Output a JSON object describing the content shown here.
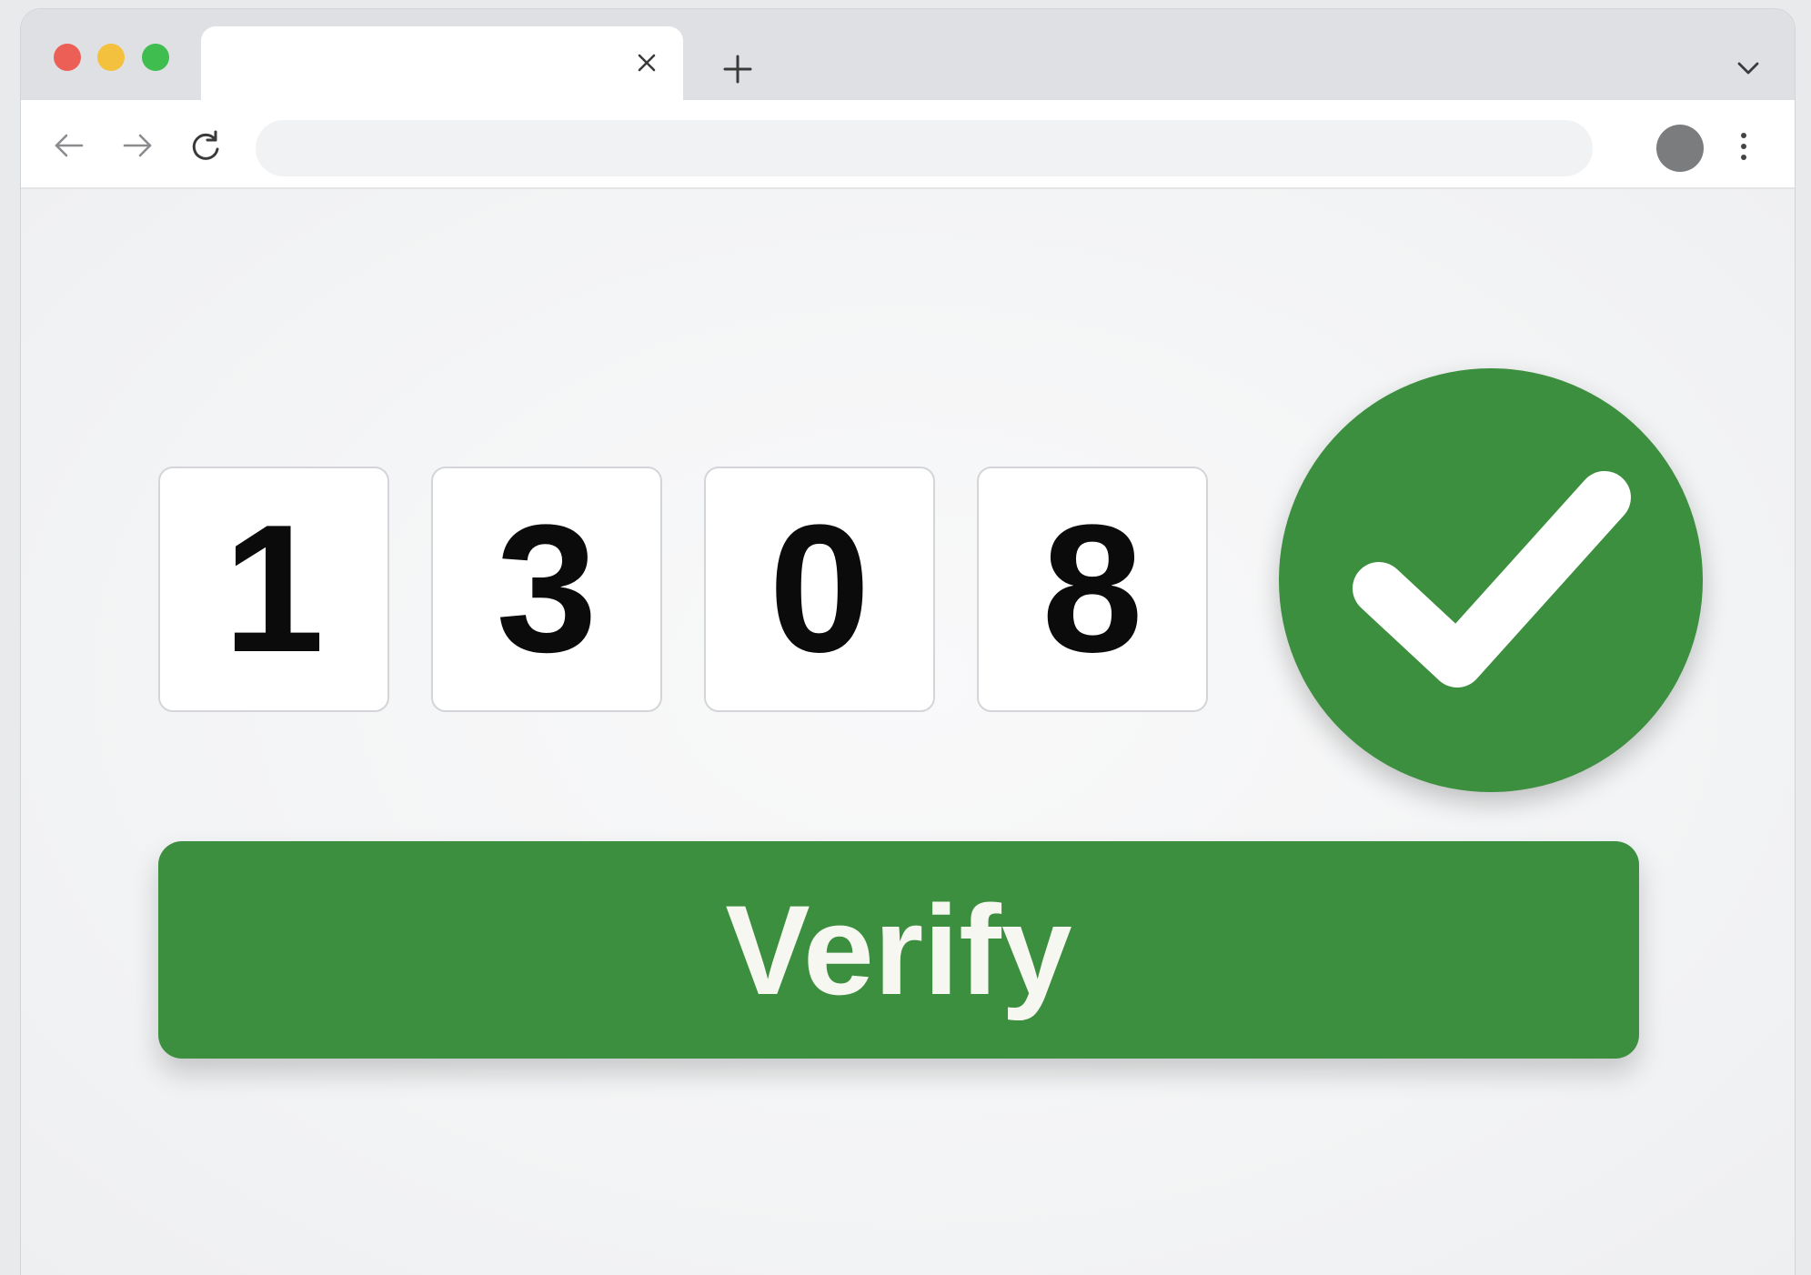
{
  "browser": {
    "tab": {
      "title": "",
      "close_icon": "close-icon"
    },
    "new_tab_icon": "plus-icon",
    "tab_menu_icon": "chevron-down-icon",
    "toolbar": {
      "back_icon": "arrow-left-icon",
      "forward_icon": "arrow-right-icon",
      "reload_icon": "reload-icon",
      "address": "",
      "profile_icon": "avatar-icon",
      "menu_icon": "kebab-menu-icon"
    },
    "traffic_lights": {
      "close_color": "#ec5f57",
      "minimize_color": "#f3c13e",
      "maximize_color": "#3fbd4f"
    }
  },
  "verification": {
    "code_digits": [
      "1",
      "3",
      "0",
      "8"
    ],
    "status_icon": "checkmark-icon",
    "status_color": "#3c8f3e",
    "verify_label": "Verify",
    "button_color": "#3c8f3e"
  }
}
